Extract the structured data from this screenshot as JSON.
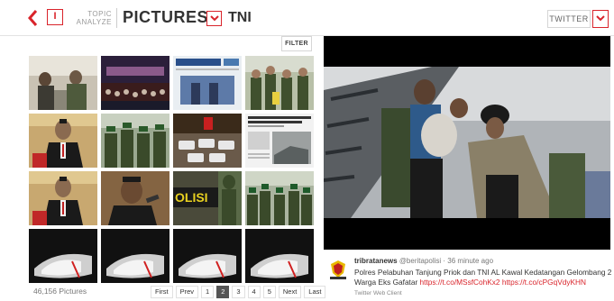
{
  "header": {
    "back_icon": "chevron-left-icon",
    "info_label": "I",
    "topic_line1": "TOPIC",
    "topic_line2": "ANALYZE",
    "title": "PICTURES",
    "subtitle": "TNI",
    "twitter_label": "TWITTER",
    "accent_color": "#d9242b"
  },
  "toolbar": {
    "filter_label": "FILTER"
  },
  "footer": {
    "count": "46,156 Pictures",
    "pages": [
      "First",
      "Prev",
      "1",
      "2",
      "3",
      "4",
      "5",
      "Next",
      "Last"
    ],
    "active_page": "2"
  },
  "tweet": {
    "user": "tribratanews",
    "handle": "@beritapolisi",
    "time": "· 36 minute ago",
    "text": "Polres Pelabuhan Tanjung Priok dan TNI AL Kawal Kedatangan Gelombang 2 Warga Eks Gafatar ",
    "link1": "https://t.co/MSsfCohKx2",
    "link2": "https://t.co/cPGqVdyKHN",
    "source": "Twitter Web Client"
  }
}
